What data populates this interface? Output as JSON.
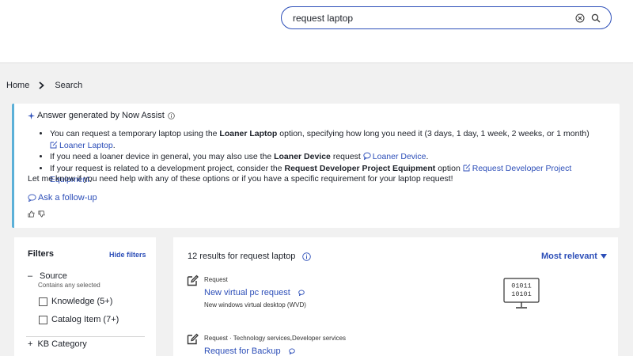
{
  "search": {
    "value": "request laptop"
  },
  "breadcrumb": {
    "home": "Home",
    "current": "Search"
  },
  "assist": {
    "header": "Answer generated by Now Assist",
    "bullets": [
      {
        "pre": "You can request a temporary laptop using the ",
        "bold": "Loaner Laptop",
        "post": " option, specifying how long you need it (3 days, 1 day, 1 week, 2 weeks, or 1 month)",
        "link": "Loaner Laptop",
        "trail": "."
      },
      {
        "pre": "If you need a loaner device in general, you may also use the ",
        "bold": "Loaner Device",
        "post": " request ",
        "link": "Loaner Device",
        "trail": "."
      },
      {
        "pre": "If your request is related to a development project, consider the ",
        "bold": "Request Developer Project Equipment",
        "post": " option ",
        "link": "Request Developer Project Equipment",
        "trail": "."
      }
    ],
    "closing": "Let me know if you need help with any of these options or if you have a specific requirement for your laptop request!",
    "follow_up": "Ask a follow-up"
  },
  "filters": {
    "title": "Filters",
    "hide": "Hide filters",
    "source_label": "Source",
    "contains": "Contains any selected",
    "options": [
      "Knowledge (5+)",
      "Catalog Item (7+)"
    ],
    "kb_category": "KB Category"
  },
  "results": {
    "count_text": "12 results for request laptop",
    "sort": "Most relevant",
    "items": [
      {
        "type": "Request",
        "title": "New virtual pc request",
        "desc": "New windows virtual desktop (WVD)"
      },
      {
        "type": "Request · Technology services,Developer services",
        "title": "Request for Backup",
        "desc": ""
      }
    ],
    "binary_text": [
      "01011",
      "10101"
    ]
  },
  "colors": {
    "link": "#2c4eb8",
    "accent_bar": "#5bb0d8",
    "background": "#f1f1f1"
  }
}
